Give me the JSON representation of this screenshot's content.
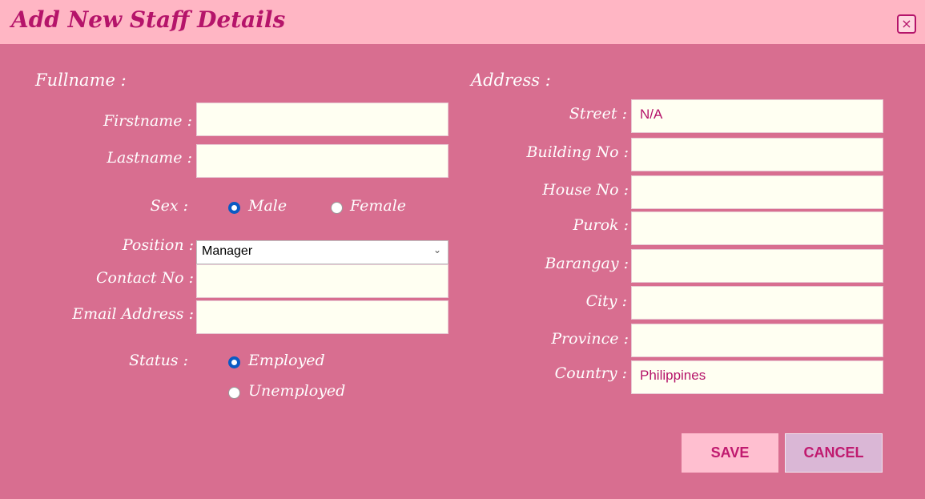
{
  "window": {
    "title": "Add New Staff Details",
    "close_label": "×"
  },
  "left": {
    "fullname_section": "Fullname :",
    "firstname_label": "Firstname :",
    "firstname_value": "",
    "lastname_label": "Lastname :",
    "lastname_value": "",
    "sex_label": "Sex :",
    "sex_options": [
      "Male",
      "Female"
    ],
    "sex_selected": "Male",
    "position_label": "Position :",
    "position_value": "Manager",
    "contact_label": "Contact No :",
    "contact_value": "",
    "email_label": "Email Address :",
    "email_value": "",
    "status_label": "Status :",
    "status_options": [
      "Employed",
      "Unemployed"
    ],
    "status_selected": "Employed"
  },
  "right": {
    "address_section": "Address :",
    "street_label": "Street :",
    "street_value": "N/A",
    "building_label": "Building No :",
    "building_value": "",
    "house_label": "House No :",
    "house_value": "",
    "purok_label": "Purok :",
    "purok_value": "",
    "barangay_label": "Barangay :",
    "barangay_value": "",
    "city_label": "City :",
    "city_value": "",
    "province_label": "Province :",
    "province_value": "",
    "country_label": "Country :",
    "country_value": "Philippines"
  },
  "buttons": {
    "save_label": "SAVE",
    "cancel_label": "CANCEL"
  },
  "colors": {
    "background": "#d86e90",
    "titlebar": "#ffb6c4",
    "accent": "#b5146a",
    "field": "#fffff2"
  }
}
